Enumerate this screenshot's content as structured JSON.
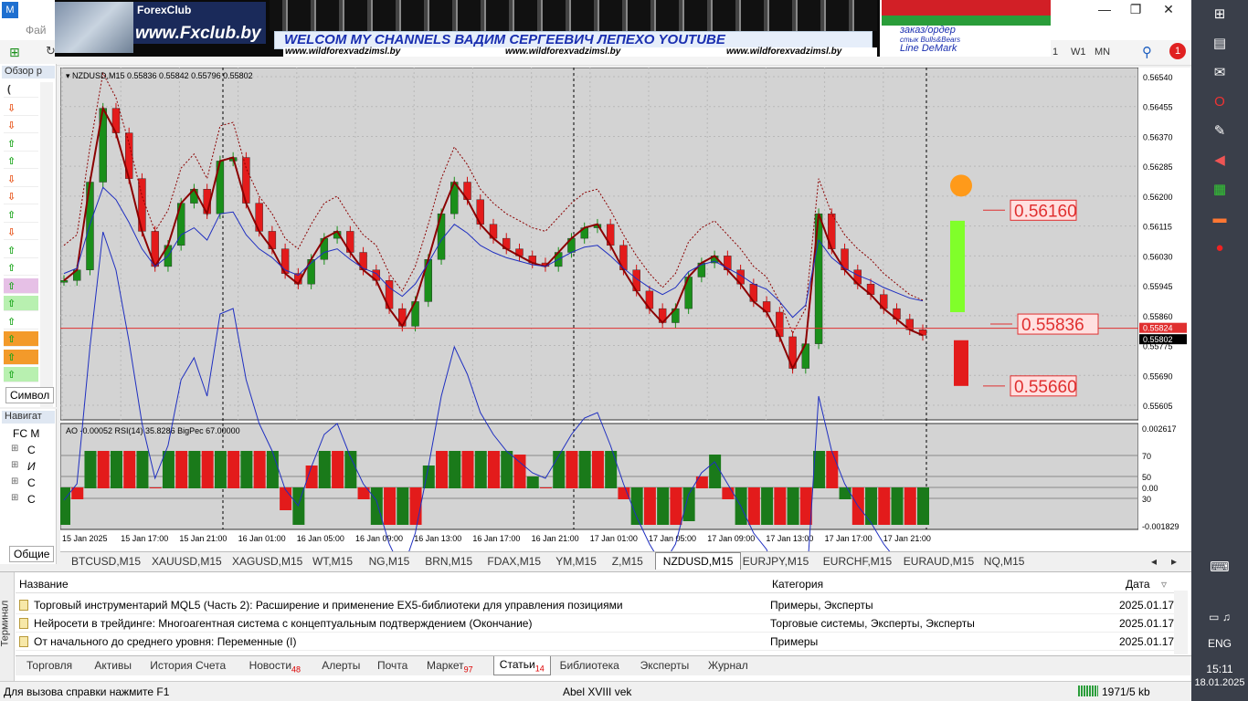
{
  "window": {
    "menu_file": "Фай",
    "minimize": "—",
    "restore": "❐",
    "close": "✕"
  },
  "toolbar": {
    "timeframes": [
      "1",
      "W1",
      "MN"
    ],
    "notif_count": "1"
  },
  "banner": {
    "logo_top": "ForexClub",
    "logo_url": "www.Fxclub.by",
    "headline": "WELCOM MY CHANNELS ВАДИМ СЕРГЕЕВИЧ ЛЕПЕХО YOUTUBE",
    "urls": [
      "www.wildforexvadzimsl.by",
      "www.wildforexvadzimsl.by",
      "www.wildforexvadzimsl.by"
    ],
    "right_1": "заказ/ордер",
    "right_2": "стык Bulls&Bears",
    "right_3": "Line DeMark"
  },
  "market_watch": {
    "title": "Обзор р",
    "tab_label": "Символ",
    "rows": [
      {
        "arrow": "(",
        "color": "#333333"
      },
      {
        "arrow": "⇩",
        "color": "#e8541a"
      },
      {
        "arrow": "⇩",
        "color": "#e8541a"
      },
      {
        "arrow": "⇧",
        "color": "#1aa51a"
      },
      {
        "arrow": "⇧",
        "color": "#1aa51a"
      },
      {
        "arrow": "⇩",
        "color": "#e8541a"
      },
      {
        "arrow": "⇩",
        "color": "#e8541a"
      },
      {
        "arrow": "⇧",
        "color": "#1aa51a"
      },
      {
        "arrow": "⇩",
        "color": "#e8541a"
      },
      {
        "arrow": "⇧",
        "color": "#1aa51a"
      },
      {
        "arrow": "⇧",
        "color": "#1aa51a"
      },
      {
        "arrow": "⇧",
        "color": "#1aa51a"
      },
      {
        "arrow": "⇧",
        "color": "#1aa51a"
      },
      {
        "arrow": "⇧",
        "color": "#1aa51a"
      },
      {
        "arrow": "⇧",
        "color": "#1aa51a"
      },
      {
        "arrow": "⇧",
        "color": "#1aa51a"
      },
      {
        "arrow": "⇧",
        "color": "#1aa51a"
      }
    ]
  },
  "navigator": {
    "title": "Навигат",
    "root": "FC M",
    "items": [
      "С",
      "И",
      "С",
      "С"
    ],
    "tab_label": "Общие"
  },
  "chart": {
    "header": "NZDUSD,M15  0.55836 0.55842 0.55796 0.55802",
    "sub_header": "AO -0.00052  RSI(14) 35.8286  BigPec 67.00000",
    "price_ticks": [
      "0.56540",
      "0.56455",
      "0.56370",
      "0.56285",
      "0.56200",
      "0.56115",
      "0.56030",
      "0.55945",
      "0.55860",
      "0.55824",
      "0.55802",
      "0.55775",
      "0.55690",
      "0.55605"
    ],
    "sub_ticks": [
      "0.002617",
      "70",
      "50",
      "0.00",
      "30",
      "-0.001829"
    ],
    "time_ticks": [
      "15 Jan 2025",
      "15 Jan 17:00",
      "15 Jan 21:00",
      "16 Jan 01:00",
      "16 Jan 05:00",
      "16 Jan 09:00",
      "16 Jan 13:00",
      "16 Jan 17:00",
      "16 Jan 21:00",
      "17 Jan 01:00",
      "17 Jan 05:00",
      "17 Jan 09:00",
      "17 Jan 13:00",
      "17 Jan 17:00",
      "17 Jan 21:00"
    ],
    "levels": [
      "0.56160",
      "0.55836",
      "0.55660"
    ]
  },
  "chart_tabs": {
    "items": [
      "BTCUSD,M15",
      "XAUUSD,M15",
      "XAGUSD,M15",
      "WT,M15",
      "NG,M15",
      "BRN,M15",
      "FDAX,M15",
      "YM,M15",
      "Z,M15",
      "NZDUSD,M15",
      "EURJPY,M15",
      "EURCHF,M15",
      "EURAUD,M15",
      "NQ,M15"
    ],
    "active": "NZDUSD,M15"
  },
  "terminal": {
    "side_label": "Терминал",
    "columns": {
      "name": "Название",
      "category": "Категория",
      "date": "Дата"
    },
    "rows": [
      {
        "name": "Торговый инструментарий MQL5 (Часть 2): Расширение и применение EX5-библиотеки для управления позициями",
        "category": "Примеры, Эксперты",
        "date": "2025.01.17"
      },
      {
        "name": "Нейросети в трейдинге: Многоагентная система с концептуальным подтверждением (Окончание)",
        "category": "Торговые системы, Эксперты, Эксперты",
        "date": "2025.01.17"
      },
      {
        "name": "От начального до среднего уровня: Переменные (I)",
        "category": "Примеры",
        "date": "2025.01.17"
      }
    ],
    "tabs": [
      {
        "label": "Торговля",
        "badge": ""
      },
      {
        "label": "Активы",
        "badge": ""
      },
      {
        "label": "История Счета",
        "badge": ""
      },
      {
        "label": "Новости",
        "badge": "48"
      },
      {
        "label": "Алерты",
        "badge": ""
      },
      {
        "label": "Почта",
        "badge": ""
      },
      {
        "label": "Маркет",
        "badge": "97"
      },
      {
        "label": "Статьи",
        "badge": "14"
      },
      {
        "label": "Библиотека",
        "badge": ""
      },
      {
        "label": "Эксперты",
        "badge": ""
      },
      {
        "label": "Журнал",
        "badge": ""
      }
    ],
    "active_tab": "Статьи"
  },
  "status": {
    "help": "Для вызова справки нажмите F1",
    "profile": "Abel XVIII vek",
    "traffic": "1971/5 kb"
  },
  "taskbar": {
    "lang": "ENG",
    "time": "15:11",
    "date": "18.01.2025"
  }
}
